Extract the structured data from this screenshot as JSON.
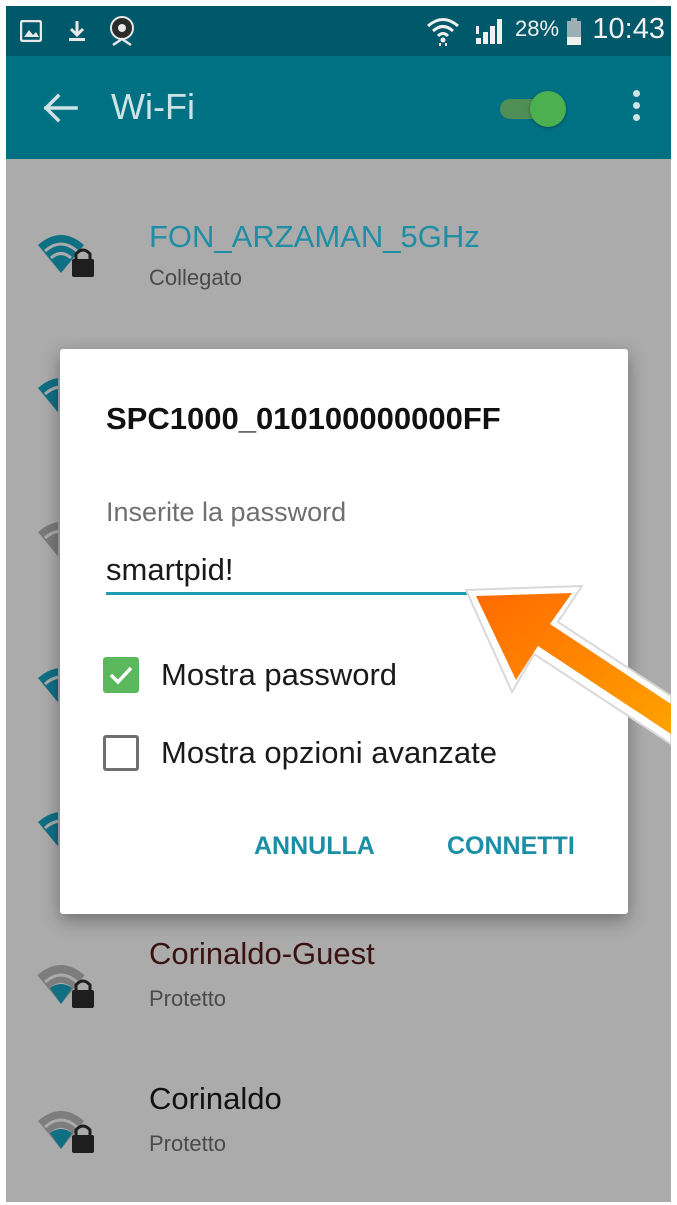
{
  "status_bar": {
    "battery_text": "28%",
    "time": "10:43",
    "icons": [
      "image-icon",
      "download-icon",
      "camera-app-icon",
      "wifi-signal-icon",
      "cell-signal-icon",
      "battery-icon"
    ]
  },
  "app_bar": {
    "title": "Wi-Fi",
    "wifi_enabled": true,
    "colors": {
      "status_bar": "#00596a",
      "app_bar": "#007083",
      "toggle_on": "#4caf50"
    }
  },
  "networks": [
    {
      "name": "FON_ARZAMAN_5GHz",
      "status": "Collegato",
      "name_color": "#1f8ea5"
    },
    {
      "name": "Corinaldo-Guest",
      "status": "Protetto",
      "name_color": "#3a1212"
    },
    {
      "name": "Corinaldo",
      "status": "Protetto",
      "name_color": "#111111"
    }
  ],
  "dialog": {
    "title": "SPC1000_010100000000FF",
    "password_label": "Inserite la password",
    "password_value": "smartpid!",
    "show_password": {
      "label": "Mostra password",
      "checked": true
    },
    "advanced_options": {
      "label": "Mostra opzioni avanzate",
      "checked": false
    },
    "cancel_label": "ANNULLA",
    "connect_label": "CONNETTI",
    "accent_color": "#1b8fa6",
    "checkbox_color": "#5cb85c"
  },
  "annotation": {
    "arrow_color": "#ff7a00"
  }
}
